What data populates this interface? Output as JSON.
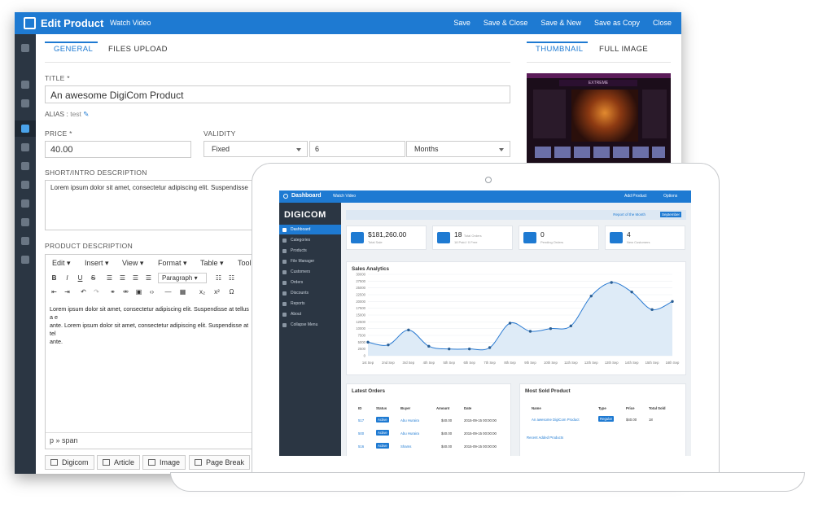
{
  "editor_window": {
    "title": "Edit Product",
    "watch_video": "Watch Video",
    "actions": [
      "Save",
      "Save & Close",
      "Save & New",
      "Save as Copy",
      "Close"
    ],
    "tabs_left": [
      "GENERAL",
      "FILES UPLOAD"
    ],
    "tabs_right": [
      "THUMBNAIL",
      "FULL IMAGE"
    ],
    "title_label": "TITLE *",
    "title_value": "An awesome DigiCom Product",
    "alias_label": "ALIAS :",
    "alias_value": "test",
    "price_label": "PRICE *",
    "price_value": "40.00",
    "validity_label": "VALIDITY",
    "validity_type": "Fixed",
    "validity_number": "6",
    "validity_unit": "Months",
    "intro_label": "SHORT/INTRO DESCRIPTION",
    "intro_text": "Lorem ipsum dolor sit amet, consectetur adipiscing elit. Suspendisse",
    "desc_label": "PRODUCT DESCRIPTION",
    "menubar": [
      "Edit",
      "Insert",
      "View",
      "Format",
      "Table",
      "Tool"
    ],
    "format_select": "Paragraph",
    "content_lines": [
      "Lorem ipsum dolor sit amet, consectetur adipiscing elit. Suspendisse at tellus a e",
      "ante. Lorem ipsum dolor sit amet, consectetur adipiscing elit. Suspendisse at tel",
      "ante."
    ],
    "statusbar": "p » span",
    "insert_buttons": [
      "Digicom",
      "Article",
      "Image",
      "Page Break"
    ],
    "thumb_banner": "EXTREME"
  },
  "dashboard": {
    "title": "Dashboard",
    "watch_video": "Watch Video",
    "add_product": "Add Product",
    "options": "Options",
    "logo": "DIGICOM",
    "menu": [
      "Dashboard",
      "Categories",
      "Products",
      "File Manager",
      "Customers",
      "Orders",
      "Discounts",
      "Reports",
      "About",
      "Collapse Menu"
    ],
    "report_label": "Report of the Month",
    "report_month": "September",
    "stats": [
      {
        "value": "$181,260.00",
        "sub": "Total Sale"
      },
      {
        "value": "18",
        "sub": "18 Paid / 0 Free",
        "inline": "Total Orders"
      },
      {
        "value": "0",
        "sub": "Pending Orders"
      },
      {
        "value": "4",
        "sub": "New Customers"
      }
    ],
    "latest_orders_title": "Latest Orders",
    "orders_headers": [
      "ID",
      "Status",
      "Buyer",
      "Amount",
      "Date"
    ],
    "orders": [
      {
        "id": "517",
        "status": "Active",
        "buyer": "Abu Huraira",
        "amount": "$40.00",
        "date": "2015-09-15 00:00:00"
      },
      {
        "id": "500",
        "status": "Active",
        "buyer": "Abu Huraira",
        "amount": "$40.00",
        "date": "2015-09-15 00:00:00"
      },
      {
        "id": "516",
        "status": "Active",
        "buyer": "Shams",
        "amount": "$40.00",
        "date": "2015-09-15 00:00:00"
      }
    ],
    "most_sold_title": "Most Sold Product",
    "sold_headers": [
      "Name",
      "Type",
      "Price",
      "Total Sold"
    ],
    "sold_rows": [
      {
        "name": "An awesome DigiCom Product",
        "type": "Regular",
        "price": "$40.00",
        "total": "18"
      }
    ],
    "recent_link": "Recent Added Products"
  },
  "chart_data": {
    "type": "line",
    "title": "Sales Analytics",
    "categories": [
      "1st Sep",
      "2nd Sep",
      "3rd Sep",
      "4th Sep",
      "5th Sep",
      "6th Sep",
      "7th Sep",
      "8th Sep",
      "9th Sep",
      "10th Sep",
      "11th Sep",
      "12th Sep",
      "13th Sep",
      "14th Sep",
      "15th Sep",
      "16th Sep"
    ],
    "series": [
      {
        "values": [
          5000,
          4000,
          9500,
          3500,
          2500,
          2500,
          3000,
          12000,
          9000,
          10000,
          11000,
          22000,
          27000,
          23500,
          17000,
          20000
        ]
      }
    ],
    "ylim": [
      0,
      30000
    ],
    "yticks": [
      0,
      2500,
      5000,
      7500,
      10000,
      12500,
      15000,
      17500,
      20000,
      22500,
      25000,
      27500,
      30000
    ],
    "grid": true,
    "colors": {
      "line": "#2b7bd2",
      "fill": "#deebf7"
    }
  }
}
